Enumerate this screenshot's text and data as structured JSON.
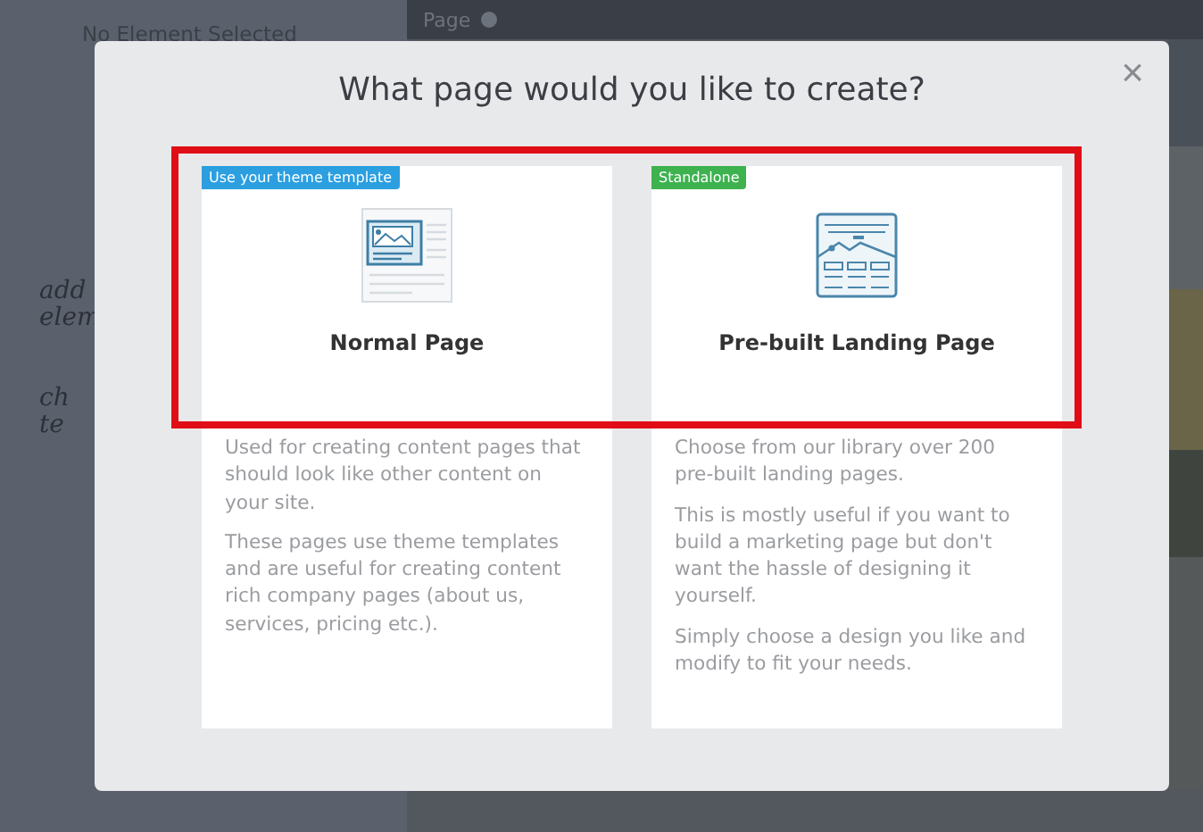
{
  "background": {
    "sidebar_heading": "No Element Selected",
    "page_tab": "Page",
    "notes": [
      "add",
      "elem",
      "ch",
      "te"
    ]
  },
  "dialog": {
    "title": "What page would you like to create?",
    "close": "×",
    "options": [
      {
        "badge": "Use your theme template",
        "color": "#2b9fe0",
        "kind": "normal",
        "title": "Normal Page",
        "paragraphs": [
          "Used for creating content pages that should look like other content on your site.",
          "These pages use theme templates and are useful for creating content rich company pages (about us, services, pricing etc.)."
        ]
      },
      {
        "badge": "Standalone",
        "color": "#3db24f",
        "kind": "landing",
        "title": "Pre-built Landing Page",
        "paragraphs": [
          "Choose from our library over 200 pre-built landing pages.",
          "This is mostly useful if you want to build a marketing page but don't want the hassle of designing it yourself.",
          "Simply choose a design you like and modify to fit your needs."
        ]
      }
    ]
  }
}
